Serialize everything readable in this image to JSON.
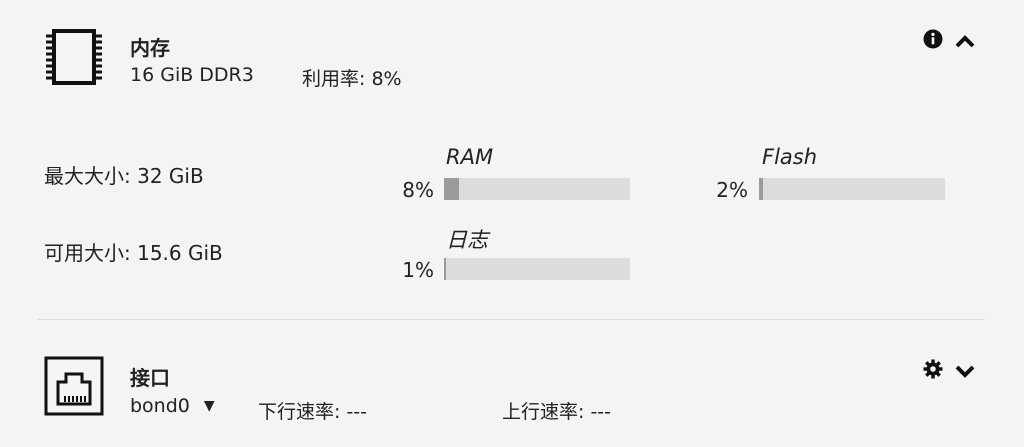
{
  "memory": {
    "title": "内存",
    "spec": "16 GiB DDR3",
    "usage_label": "利用率: 8%",
    "max_size": "最大大小: 32 GiB",
    "available_size": "可用大小: 15.6 GiB",
    "bars": [
      {
        "name": "RAM",
        "percent_label": "8%",
        "value": 8
      },
      {
        "name": "Flash",
        "percent_label": "2%",
        "value": 2
      },
      {
        "name": "日志",
        "percent_label": "1%",
        "value": 1
      }
    ],
    "icons": {
      "info": "info-icon",
      "collapse": "chevron-up-icon"
    }
  },
  "interface": {
    "title": "接口",
    "selected": "bond0",
    "dropdown_arrow": "▼",
    "down_rate": "下行速率: ---",
    "up_rate": "上行速率: ---",
    "icons": {
      "settings": "gear-icon",
      "expand": "chevron-down-icon"
    }
  }
}
